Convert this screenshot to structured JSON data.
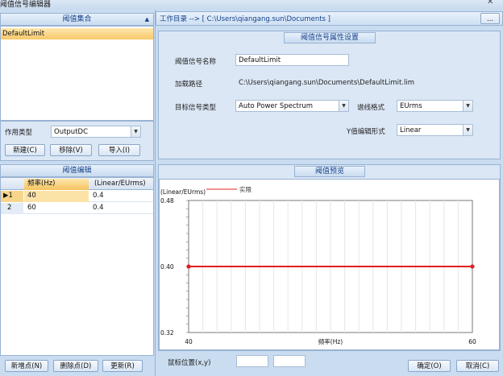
{
  "window": {
    "title": "阈值信号编辑器"
  },
  "left": {
    "collection_header": "阈值集合",
    "collection_items": [
      "DefaultLimit"
    ],
    "scope_label": "作用类型",
    "scope_value": "OutputDC",
    "buttons": {
      "new": "新建(C)",
      "remove": "移除(V)",
      "import": "导入(I)"
    },
    "editor_header": "阈值编辑",
    "table": {
      "columns": [
        "频率(Hz)",
        "(Linear/EUrms)"
      ],
      "rows": [
        {
          "index": "1",
          "freq": "40",
          "value": "0.4"
        },
        {
          "index": "2",
          "freq": "60",
          "value": "0.4"
        }
      ]
    },
    "bottom_buttons": {
      "add_point": "新增点(N)",
      "delete_point": "删除点(D)",
      "update": "更新(R)"
    }
  },
  "right": {
    "workdir_label": "工作目录 --> [  C:\\Users\\qiangang.sun\\Documents ]",
    "more_button": "...",
    "props_header": "阈值信号属性设置",
    "name_label": "阈值信号名称",
    "name_value": "DefaultLimit",
    "path_label": "加载路径",
    "path_value": "C:\\Users\\qiangang.sun\\Documents\\DefaultLimit.lim",
    "signal_type_label": "目标信号类型",
    "signal_type_value": "Auto Power Spectrum",
    "spectrum_format_label": "谱线格式",
    "spectrum_format_value": "EUrms",
    "y_format_label": "Y值编辑形式",
    "y_format_value": "Linear",
    "preview_header": "阈值预览",
    "cursor_label": "鼠标位置(x,y)",
    "ok": "确定(O)",
    "cancel": "取消(C)"
  },
  "chart_data": {
    "type": "line",
    "legend": [
      "实限"
    ],
    "ylabel": "(Linear/EUrms)",
    "xlabel": "频率(Hz)",
    "x_ticks": [
      "40",
      "60"
    ],
    "y_ticks": [
      "0.48",
      "0.40",
      "0.32"
    ],
    "xlim": [
      40,
      60
    ],
    "ylim": [
      0.32,
      0.48
    ],
    "series": [
      {
        "name": "实限",
        "x": [
          40,
          60
        ],
        "y": [
          0.4,
          0.4
        ],
        "color": "#e02020"
      }
    ],
    "grid": true
  }
}
